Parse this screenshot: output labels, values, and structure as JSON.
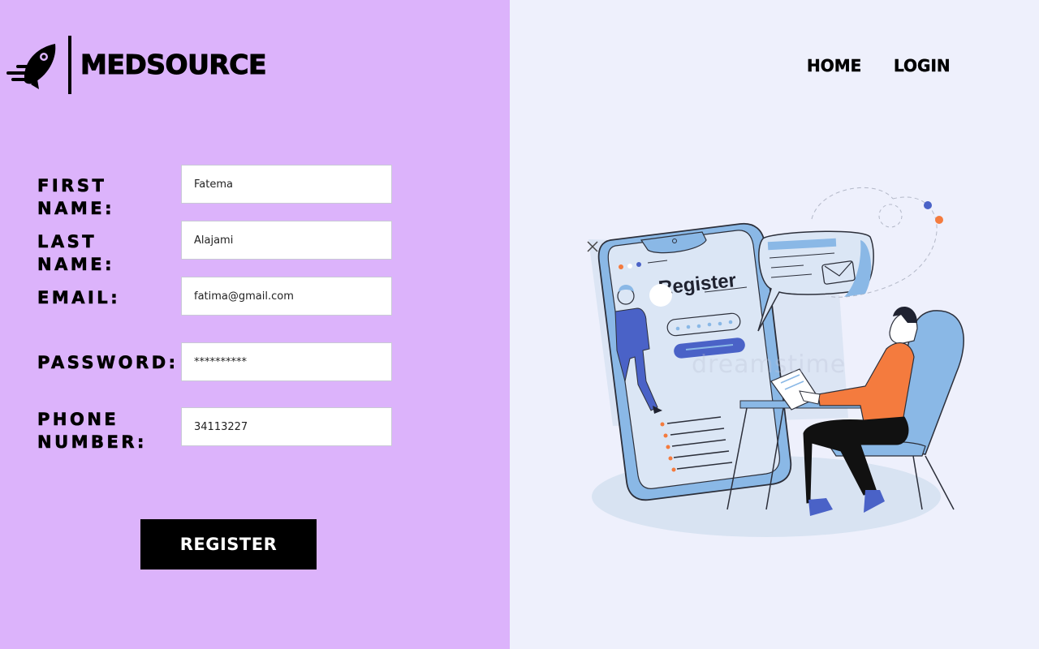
{
  "brand": {
    "name": "MEDSOURCE",
    "logo_icon": "rocket-speed-icon"
  },
  "nav": {
    "home_label": "HOME",
    "login_label": "LOGIN"
  },
  "form": {
    "first_name": {
      "label": "FIRST NAME:",
      "value": "Fatema"
    },
    "last_name": {
      "label": "LAST NAME:",
      "value": "Alajami"
    },
    "email": {
      "label": "EMAIL:",
      "value": "fatima@gmail.com"
    },
    "password": {
      "label": "PASSWORD:",
      "value": "**********"
    },
    "phone": {
      "label": "PHONE NUMBER:",
      "value": "34113227"
    },
    "submit_label": "REGISTER"
  },
  "illustration": {
    "screen_title": "Register",
    "watermark": "dreamstime"
  },
  "colors": {
    "left_panel_bg": "#dcb3fb",
    "right_panel_bg": "#eef0fc",
    "button_bg": "#000000",
    "illustration_blue": "#8ab8e6",
    "illustration_orange": "#f47b3e",
    "illustration_indigo": "#4a62c7"
  }
}
